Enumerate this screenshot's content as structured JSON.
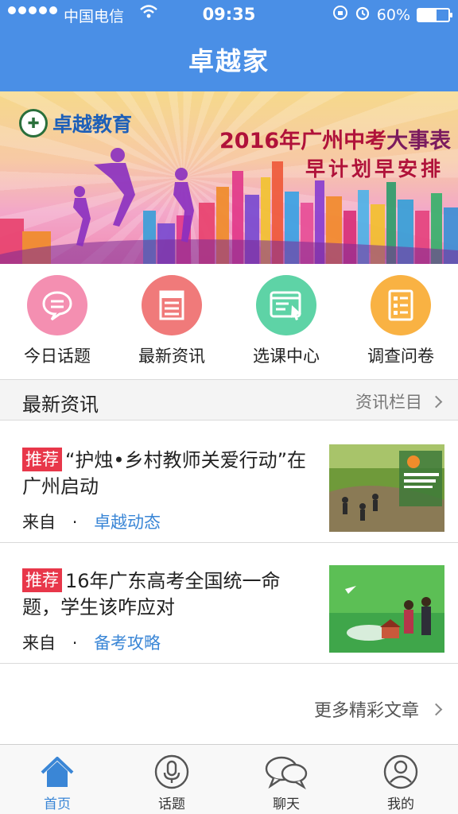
{
  "status_bar": {
    "carrier": "中国电信",
    "time": "09:35",
    "battery": "60%",
    "battery_level": 0.6
  },
  "header": {
    "title": "卓越家"
  },
  "banner": {
    "logo_text": "卓越教育",
    "headline_year": "2016年",
    "headline_city": "广州中考",
    "headline_rest": "大事表",
    "subline": "早计划早安排"
  },
  "quick_menu": [
    {
      "label": "今日话题",
      "icon": "chat-bubble-icon",
      "color": "#f48fb1"
    },
    {
      "label": "最新资讯",
      "icon": "news-icon",
      "color": "#f07a7a"
    },
    {
      "label": "选课中心",
      "icon": "course-select-icon",
      "color": "#5ed3a6"
    },
    {
      "label": "调查问卷",
      "icon": "survey-icon",
      "color": "#f9b243"
    }
  ],
  "section": {
    "title": "最新资讯",
    "link": "资讯栏目"
  },
  "news": [
    {
      "tag": "推荐",
      "title": "“护烛•乡村教师关爱行动”在广州启动",
      "from_label": "来自",
      "dot": "·",
      "source": "卓越动态"
    },
    {
      "tag": "推荐",
      "title": "16年广东高考全国统一命题，学生该咋应对",
      "from_label": "来自",
      "dot": "·",
      "source": "备考攻略"
    }
  ],
  "more_link": "更多精彩文章",
  "tabbar": [
    {
      "label": "首页",
      "icon": "home-icon",
      "active": true
    },
    {
      "label": "话题",
      "icon": "microphone-icon",
      "active": false
    },
    {
      "label": "聊天",
      "icon": "chat-icon",
      "active": false
    },
    {
      "label": "我的",
      "icon": "profile-icon",
      "active": false
    }
  ],
  "colors": {
    "accent": "#4a8fe6",
    "tag_red": "#e8374a",
    "link_blue": "#3a86d6"
  }
}
